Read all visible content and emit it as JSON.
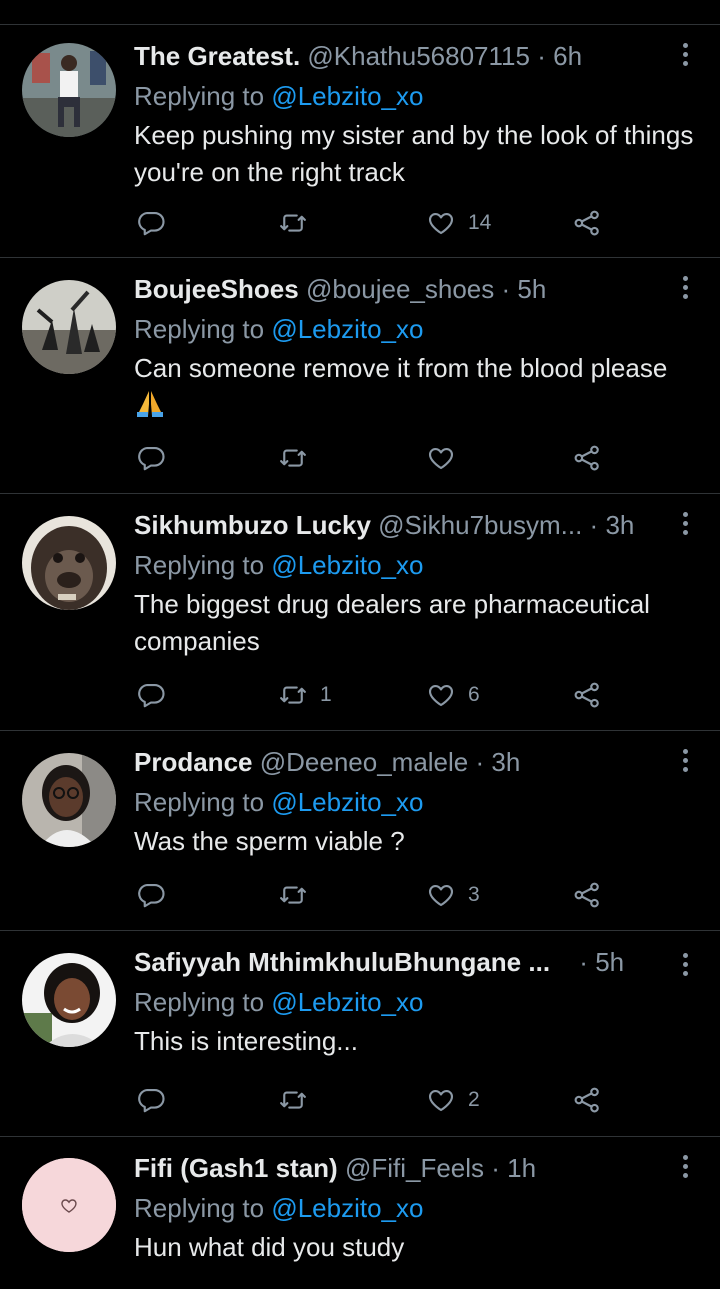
{
  "replying_label": "Replying to",
  "colors": {
    "background": "#000000",
    "link": "#1d9bf0",
    "muted": "#8b98a5",
    "text": "#e7e9ea",
    "divider": "#2f3336"
  },
  "tweets": [
    {
      "name": "The Greatest.",
      "handle": "@Khathu56807115",
      "separator": "·",
      "time": "6h",
      "reply_to": "@Lebzito_xo",
      "text": "Keep pushing my sister and by the look of things you're on the right track",
      "retweets": "",
      "likes": "14"
    },
    {
      "name": "BoujeeShoes",
      "handle": "@boujee_shoes",
      "separator": "·",
      "time": "5h",
      "reply_to": "@Lebzito_xo",
      "text": "Can someone remove it from the blood please",
      "emoji": "folded-hands",
      "retweets": "",
      "likes": ""
    },
    {
      "name": "Sikhumbuzo Lucky",
      "handle": "@Sikhu7busym...",
      "separator": "·",
      "time": "3h",
      "reply_to": "@Lebzito_xo",
      "text": "The biggest drug dealers are pharmaceutical companies",
      "retweets": "1",
      "likes": "6"
    },
    {
      "name": "Prodance",
      "handle": "@Deeneo_malele",
      "separator": "·",
      "time": "3h",
      "reply_to": "@Lebzito_xo",
      "text": "Was the sperm viable ?",
      "retweets": "",
      "likes": "3"
    },
    {
      "name": "Safiyyah MthimkhuluBhungane ...",
      "handle": "",
      "separator": "·",
      "time": "5h",
      "reply_to": "@Lebzito_xo",
      "text": "This is interesting...",
      "retweets": "",
      "likes": "2"
    },
    {
      "name": "Fifi (Gash1 stan)",
      "handle": "@Fifi_Feels",
      "separator": "·",
      "time": "1h",
      "reply_to": "@Lebzito_xo",
      "text": "Hun what did you study",
      "retweets": "",
      "likes": ""
    }
  ]
}
